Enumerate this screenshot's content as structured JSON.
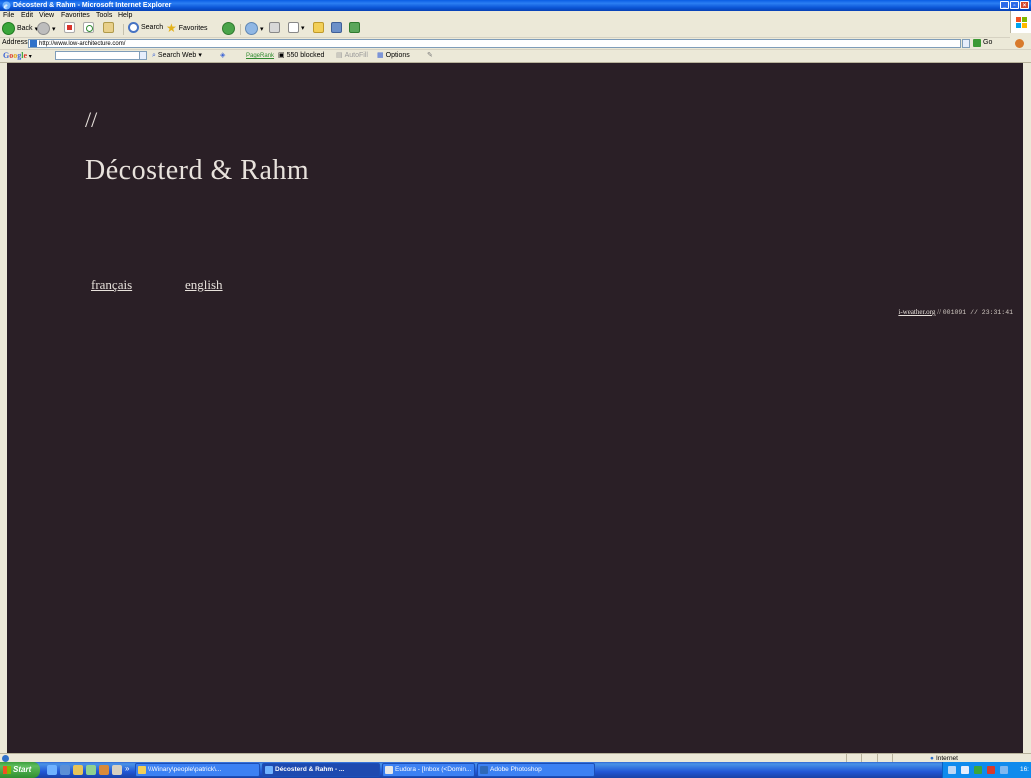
{
  "window": {
    "title": "Décosterd & Rahm - Microsoft Internet Explorer",
    "buttons": {
      "minimize": "_",
      "maximize": "▫",
      "close": "×"
    }
  },
  "menu": [
    "File",
    "Edit",
    "View",
    "Favorites",
    "Tools",
    "Help"
  ],
  "toolbar": {
    "back": "Back",
    "search": "Search",
    "favorites": "Favorites"
  },
  "address": {
    "label": "Address",
    "url": "http://www.low-architecture.com/",
    "go": "Go"
  },
  "google_bar": {
    "logo": "Google -",
    "search_web": "Search Web",
    "pagerank": "PageRank",
    "blocked": "550 blocked",
    "autofill": "AutoFill",
    "options": "Options"
  },
  "page": {
    "slashes": "//",
    "title": "Décosterd & Rahm",
    "languages": [
      "français",
      "english"
    ],
    "weather_link": "i-weather.org",
    "weather_sep": "//",
    "weather_code": "001091 // 23:31:41"
  },
  "status": {
    "zone": "Internet"
  },
  "taskbar": {
    "start": "Start",
    "overflow": "»",
    "tasks": [
      "\\\\Winary\\people\\patrick\\...",
      "Décosterd & Rahm - ...",
      "Eudora - [Inbox (<Domin...",
      "Adobe Photoshop"
    ],
    "clock": "16:"
  },
  "colors": {
    "page_bg": "#2a1f26",
    "page_text": "#e8e2dc",
    "xp_chrome": "#ece9d8",
    "titlebar": "#0a5de4"
  }
}
